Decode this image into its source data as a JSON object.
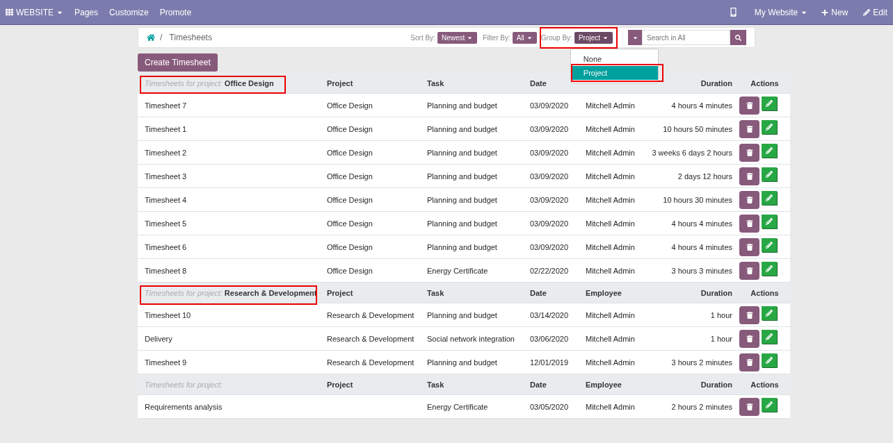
{
  "navbar": {
    "brand": "WEBSITE",
    "items": [
      "Pages",
      "Customize",
      "Promote"
    ],
    "site": "My Website",
    "new": "New",
    "edit": "Edit"
  },
  "breadcrumb": {
    "separator": "/",
    "current": "Timesheets"
  },
  "toolbar": {
    "sort_label": "Sort By:",
    "sort_value": "Newest",
    "filter_label": "Filter By:",
    "filter_value": "All",
    "group_label": "Group By:",
    "group_value": "Project",
    "group_highlighted": true,
    "search_placeholder": "Search in All",
    "group_menu": [
      {
        "label": "None",
        "selected": false,
        "highlighted": false
      },
      {
        "label": "Project",
        "selected": true,
        "highlighted": true
      }
    ]
  },
  "create_button": "Create Timesheet",
  "groups": [
    {
      "prefix": "Timesheets for project:",
      "name": "Office Design",
      "highlighted": true,
      "headers": {
        "project": "Project",
        "task": "Task",
        "date": "Date",
        "duration": "Duration",
        "actions": "Actions"
      },
      "rows": [
        {
          "name": "Timesheet 7",
          "project": "Office Design",
          "task": "Planning and budget",
          "date": "03/09/2020",
          "employee": "Mitchell Admin",
          "duration": "4 hours 4 minutes"
        },
        {
          "name": "Timesheet 1",
          "project": "Office Design",
          "task": "Planning and budget",
          "date": "03/09/2020",
          "employee": "Mitchell Admin",
          "duration": "10 hours 50 minutes"
        },
        {
          "name": "Timesheet 2",
          "project": "Office Design",
          "task": "Planning and budget",
          "date": "03/09/2020",
          "employee": "Mitchell Admin",
          "duration": "3 weeks 6 days 2 hours"
        },
        {
          "name": "Timesheet 3",
          "project": "Office Design",
          "task": "Planning and budget",
          "date": "03/09/2020",
          "employee": "Mitchell Admin",
          "duration": "2 days 12 hours"
        },
        {
          "name": "Timesheet 4",
          "project": "Office Design",
          "task": "Planning and budget",
          "date": "03/09/2020",
          "employee": "Mitchell Admin",
          "duration": "10 hours 30 minutes"
        },
        {
          "name": "Timesheet 5",
          "project": "Office Design",
          "task": "Planning and budget",
          "date": "03/09/2020",
          "employee": "Mitchell Admin",
          "duration": "4 hours 4 minutes"
        },
        {
          "name": "Timesheet 6",
          "project": "Office Design",
          "task": "Planning and budget",
          "date": "03/09/2020",
          "employee": "Mitchell Admin",
          "duration": "4 hours 4 minutes"
        },
        {
          "name": "Timesheet 8",
          "project": "Office Design",
          "task": "Energy Certificate",
          "date": "02/22/2020",
          "employee": "Mitchell Admin",
          "duration": "3 hours 3 minutes"
        }
      ]
    },
    {
      "prefix": "Timesheets for project:",
      "name": "Research & Development",
      "highlighted": true,
      "headers": {
        "project": "Project",
        "task": "Task",
        "date": "Date",
        "employee": "Employee",
        "duration": "Duration",
        "actions": "Actions"
      },
      "rows": [
        {
          "name": "Timesheet 10",
          "project": "Research & Development",
          "task": "Planning and budget",
          "date": "03/14/2020",
          "employee": "Mitchell Admin",
          "duration": "1 hour"
        },
        {
          "name": "Delivery",
          "project": "Research & Development",
          "task": "Social network integration",
          "date": "03/06/2020",
          "employee": "Mitchell Admin",
          "duration": "1 hour"
        },
        {
          "name": "Timesheet 9",
          "project": "Research & Development",
          "task": "Planning and budget",
          "date": "12/01/2019",
          "employee": "Mitchell Admin",
          "duration": "3 hours 2 minutes"
        }
      ]
    },
    {
      "prefix": "Timesheets for project:",
      "highlighted": false,
      "headers": {
        "project": "Project",
        "task": "Task",
        "date": "Date",
        "employee": "Employee",
        "duration": "Duration",
        "actions": "Actions"
      },
      "rows": [
        {
          "name": "Requirements analysis",
          "task": "Energy Certificate",
          "date": "03/05/2020",
          "employee": "Mitchell Admin",
          "duration": "2 hours 2 minutes"
        }
      ]
    }
  ]
}
